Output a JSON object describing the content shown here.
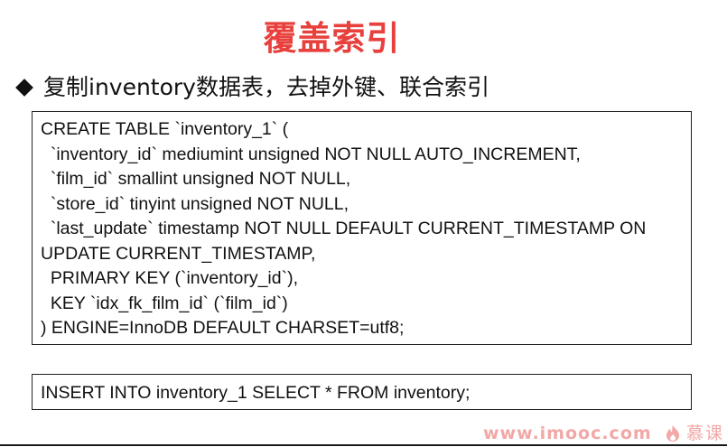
{
  "slide": {
    "title": "覆盖索引",
    "bullet": "复制inventory数据表，去掉外键、联合索引"
  },
  "code_block": {
    "lines": [
      "CREATE TABLE `inventory_1` (",
      "  `inventory_id` mediumint unsigned NOT NULL AUTO_INCREMENT,",
      "  `film_id` smallint unsigned NOT NULL,",
      "  `store_id` tinyint unsigned NOT NULL,",
      "  `last_update` timestamp NOT NULL DEFAULT CURRENT_TIMESTAMP ON",
      "UPDATE CURRENT_TIMESTAMP,",
      "  PRIMARY KEY (`inventory_id`),",
      "  KEY `idx_fk_film_id` (`film_id`)",
      ") ENGINE=InnoDB DEFAULT CHARSET=utf8;"
    ]
  },
  "insert_block": {
    "text": "INSERT INTO inventory_1 SELECT * FROM inventory;"
  },
  "watermark": {
    "url": "www.imooc.com",
    "logo_text": "慕课",
    "logo_icon": "flame-icon",
    "color": "#f1a8a6"
  },
  "colors": {
    "title": "#e8403d",
    "text": "#111111",
    "border": "#222222"
  }
}
